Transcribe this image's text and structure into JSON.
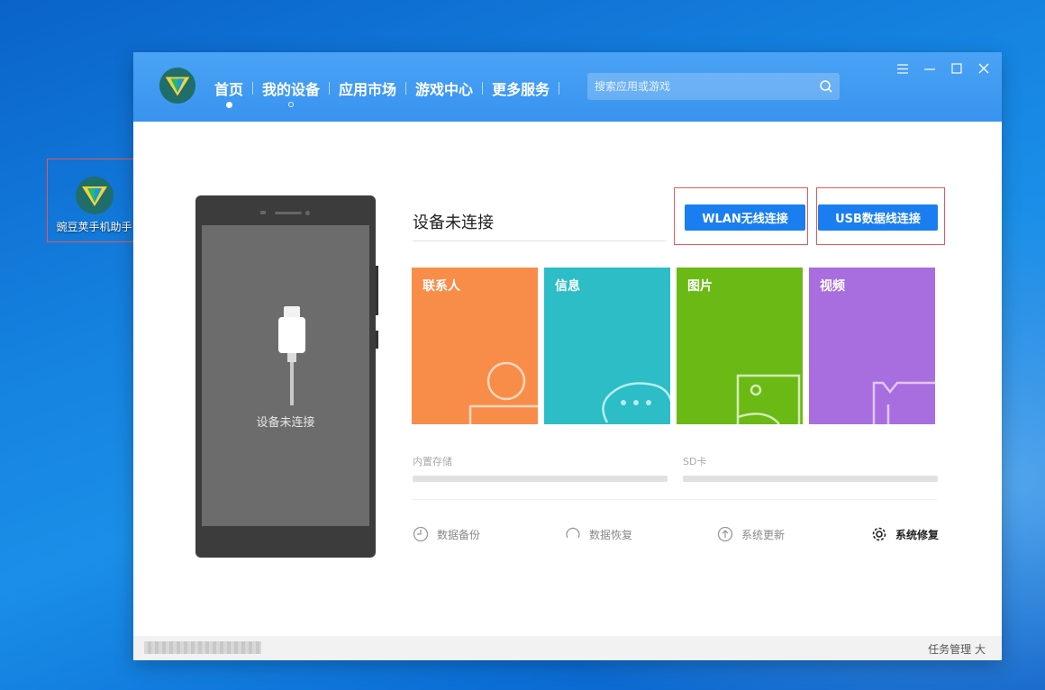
{
  "desktop": {
    "icon_label": "豌豆荚手机助手"
  },
  "header": {
    "nav": [
      {
        "label": "首页",
        "active": true
      },
      {
        "label": "我的设备",
        "active": false
      },
      {
        "label": "应用市场",
        "active": false
      },
      {
        "label": "游戏中心",
        "active": false
      },
      {
        "label": "更多服务",
        "active": false
      }
    ],
    "search_placeholder": "搜索应用或游戏",
    "window_controls": [
      "menu-icon",
      "minimize-icon",
      "maximize-icon",
      "close-icon"
    ]
  },
  "phone": {
    "status_text": "设备未连接"
  },
  "main": {
    "status_title": "设备未连接",
    "wlan_button": "WLAN无线连接",
    "usb_button": "USB数据线连接",
    "tiles": [
      {
        "label": "联系人",
        "color": "#f88d49",
        "icon": "avatar-icon"
      },
      {
        "label": "信息",
        "color": "#2cbdc6",
        "icon": "chat-icon"
      },
      {
        "label": "图片",
        "color": "#6bb915",
        "icon": "image-icon"
      },
      {
        "label": "视频",
        "color": "#a86ee0",
        "icon": "video-icon"
      }
    ],
    "storage": {
      "internal_label": "内置存储",
      "sd_label": "SD卡"
    },
    "actions": [
      {
        "label": "数据备份",
        "icon": "backup-icon"
      },
      {
        "label": "数据恢复",
        "icon": "restore-icon"
      },
      {
        "label": "系统更新",
        "icon": "update-icon"
      },
      {
        "label": "系统修复",
        "icon": "gear-icon"
      }
    ]
  },
  "footer": {
    "left_text": "",
    "right_text": "任务管理 大"
  },
  "colors": {
    "accent": "#1a7ef0",
    "header": "#3893ef",
    "highlight_box": "#e8585c"
  }
}
